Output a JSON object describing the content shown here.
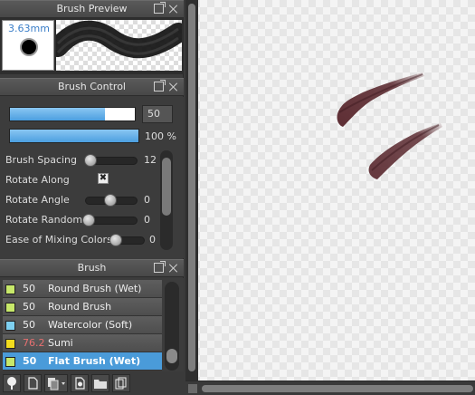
{
  "preview_panel": {
    "title": "Brush Preview",
    "size_label": "3.63mm"
  },
  "control_panel": {
    "title": "Brush Control",
    "size_value": "50",
    "size_fraction": 0.76,
    "opacity_value": "100 %",
    "opacity_fraction": 1.0,
    "properties": [
      {
        "label": "Brush Spacing",
        "type": "slider",
        "value": "12",
        "level": 0.05
      },
      {
        "label": "Rotate Along",
        "type": "checkbox",
        "checked": true,
        "mark": "✖"
      },
      {
        "label": "Rotate Angle",
        "type": "slider",
        "value": "0",
        "level": 0.5
      },
      {
        "label": "Rotate Random",
        "type": "slider",
        "value": "0",
        "level": 0.0
      },
      {
        "label": "Ease of Mixing Colors",
        "type": "slider",
        "value": "0",
        "level": 0.0
      }
    ]
  },
  "brush_panel": {
    "title": "Brush",
    "items": [
      {
        "size": "50",
        "name": "Round Brush (Wet)",
        "swatch": "#c7e86a",
        "selected": false,
        "size_color": "normal"
      },
      {
        "size": "50",
        "name": "Round Brush",
        "swatch": "#c7e86a",
        "selected": false,
        "size_color": "normal"
      },
      {
        "size": "50",
        "name": "Watercolor (Soft)",
        "swatch": "#7ed0f0",
        "selected": false,
        "size_color": "normal"
      },
      {
        "size": "76.2",
        "name": "Sumi",
        "swatch": "#f2dc1e",
        "selected": false,
        "size_color": "red"
      },
      {
        "size": "50",
        "name": "Flat Brush (Wet)",
        "swatch": "#c7e86a",
        "selected": true,
        "size_color": "normal"
      }
    ],
    "toolbar": [
      "paint-icon",
      "new-brush-icon",
      "group-menu-icon",
      "settings-icon",
      "folder-icon",
      "copy-icon"
    ]
  },
  "colors": {
    "accent": "#4a9bd9",
    "stroke": "#5e2e34",
    "panel": "#3c3c3c"
  }
}
